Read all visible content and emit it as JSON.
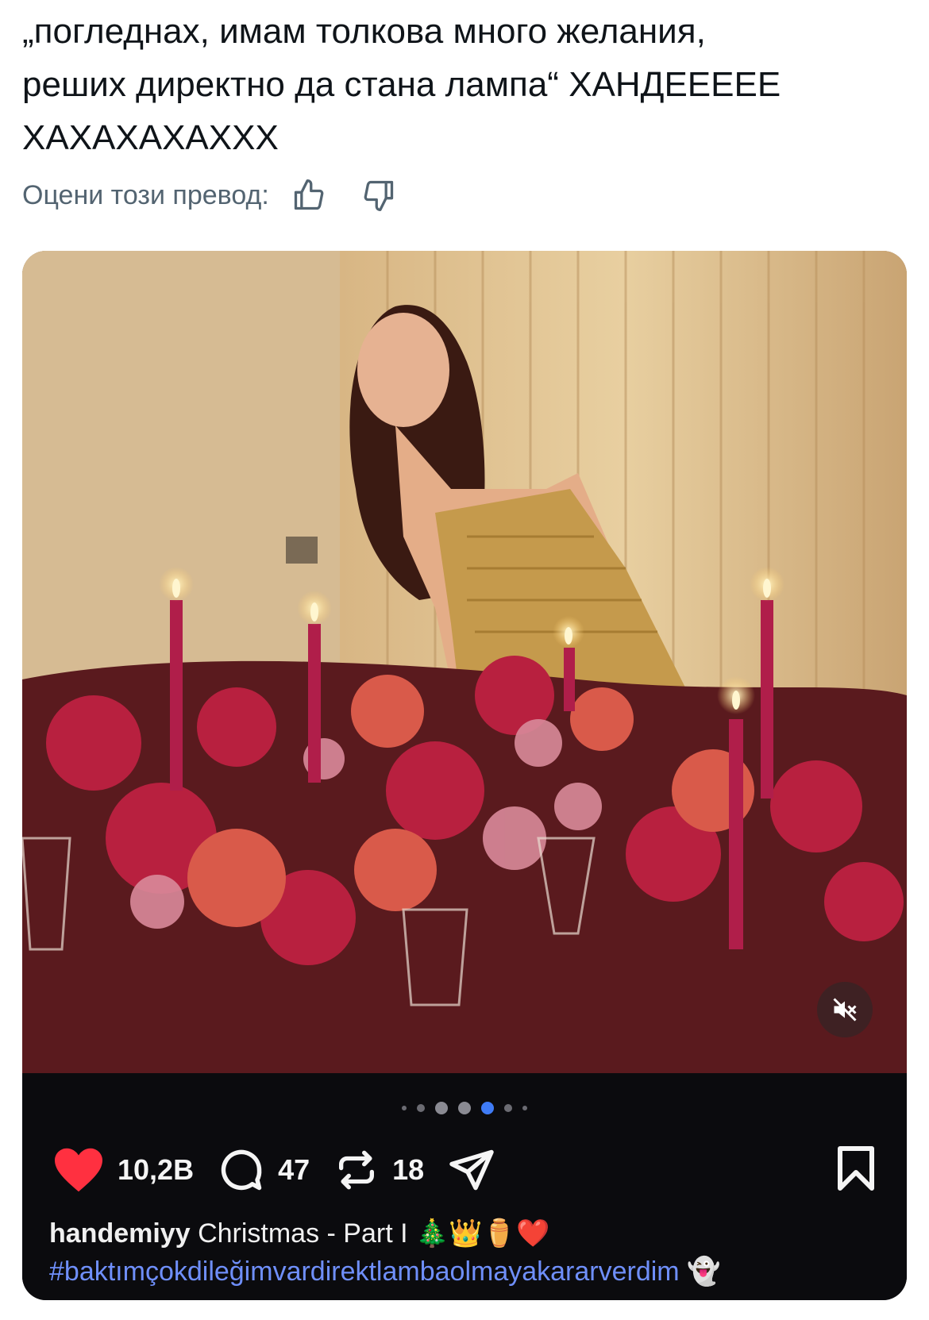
{
  "tweet": {
    "text": "„погледнах, имам толкова много желания,\nреших директно да стана лампа“ ХАНДЕЕЕЕЕ\nХАХАХАХАХХХ"
  },
  "translation_rating": {
    "label": "Оцени този превод:",
    "thumbs_up_icon": "thumbs-up-icon",
    "thumbs_down_icon": "thumbs-down-icon"
  },
  "media": {
    "mute_icon": "speaker-muted-icon",
    "carousel": {
      "count": 7,
      "active_index": 4
    },
    "actions": {
      "likes": "10,2В",
      "comments": "47",
      "reposts": "18"
    },
    "caption": {
      "username": "handemiyy",
      "text": "Christmas - Part I 🎄👑⚱️❤️",
      "hashtag": "#baktımçokdileğimvardirektlambaolmayakararverdim 👻"
    }
  },
  "colors": {
    "text_primary": "#0f1419",
    "text_secondary": "#536471",
    "like_red": "#ff3040",
    "active_dot": "#3f7bf5",
    "hashtag": "#6f8ffb"
  }
}
